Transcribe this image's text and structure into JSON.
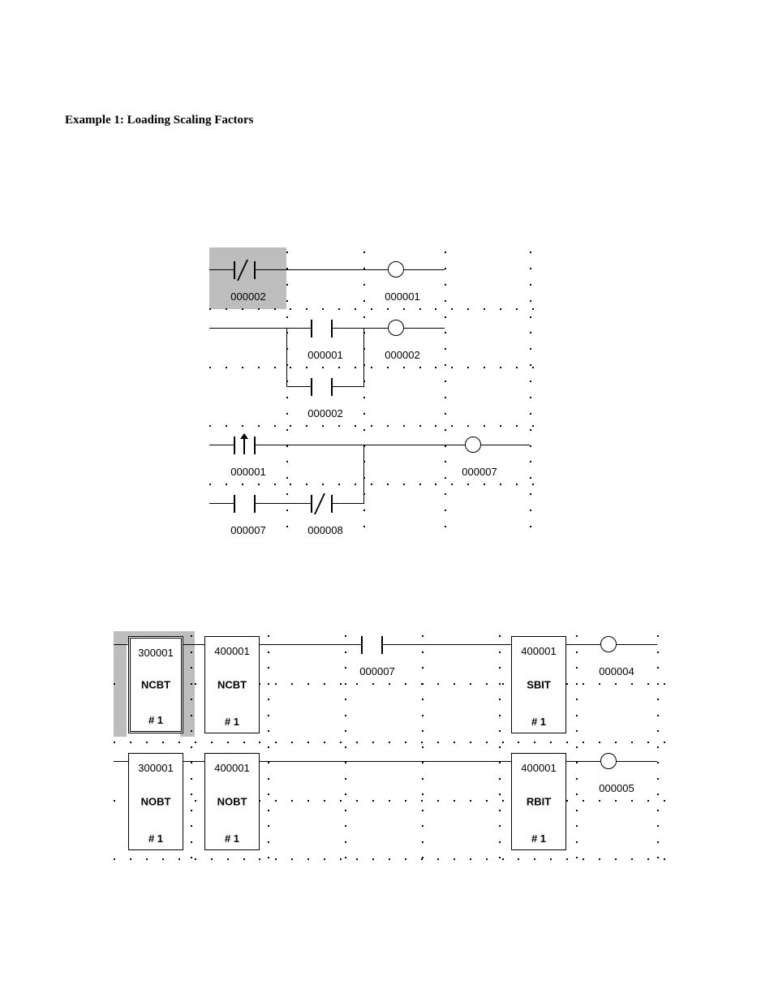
{
  "title": "Example 1:  Loading Scaling Factors",
  "diagram1": {
    "r1": {
      "contact": "000002",
      "coil": "000001"
    },
    "r2": {
      "contact1": "000001",
      "contact2_branch": "000002",
      "coil": "000002"
    },
    "r3": {
      "contact": "000001",
      "coil": "000007"
    },
    "r4": {
      "contact1": "000007",
      "contact2": "000008"
    }
  },
  "diagram2": {
    "row1": {
      "b1": {
        "addr": "300001",
        "name": "NCBT",
        "idx": "# 1"
      },
      "b2": {
        "addr": "400001",
        "name": "NCBT",
        "idx": "# 1"
      },
      "contact": "000007",
      "b3": {
        "addr": "400001",
        "name": "SBIT",
        "idx": "# 1"
      },
      "coil": "000004"
    },
    "row2": {
      "b1": {
        "addr": "300001",
        "name": "NOBT",
        "idx": "# 1"
      },
      "b2": {
        "addr": "400001",
        "name": "NOBT",
        "idx": "# 1"
      },
      "b3": {
        "addr": "400001",
        "name": "RBIT",
        "idx": "# 1"
      },
      "coil": "000005"
    }
  }
}
